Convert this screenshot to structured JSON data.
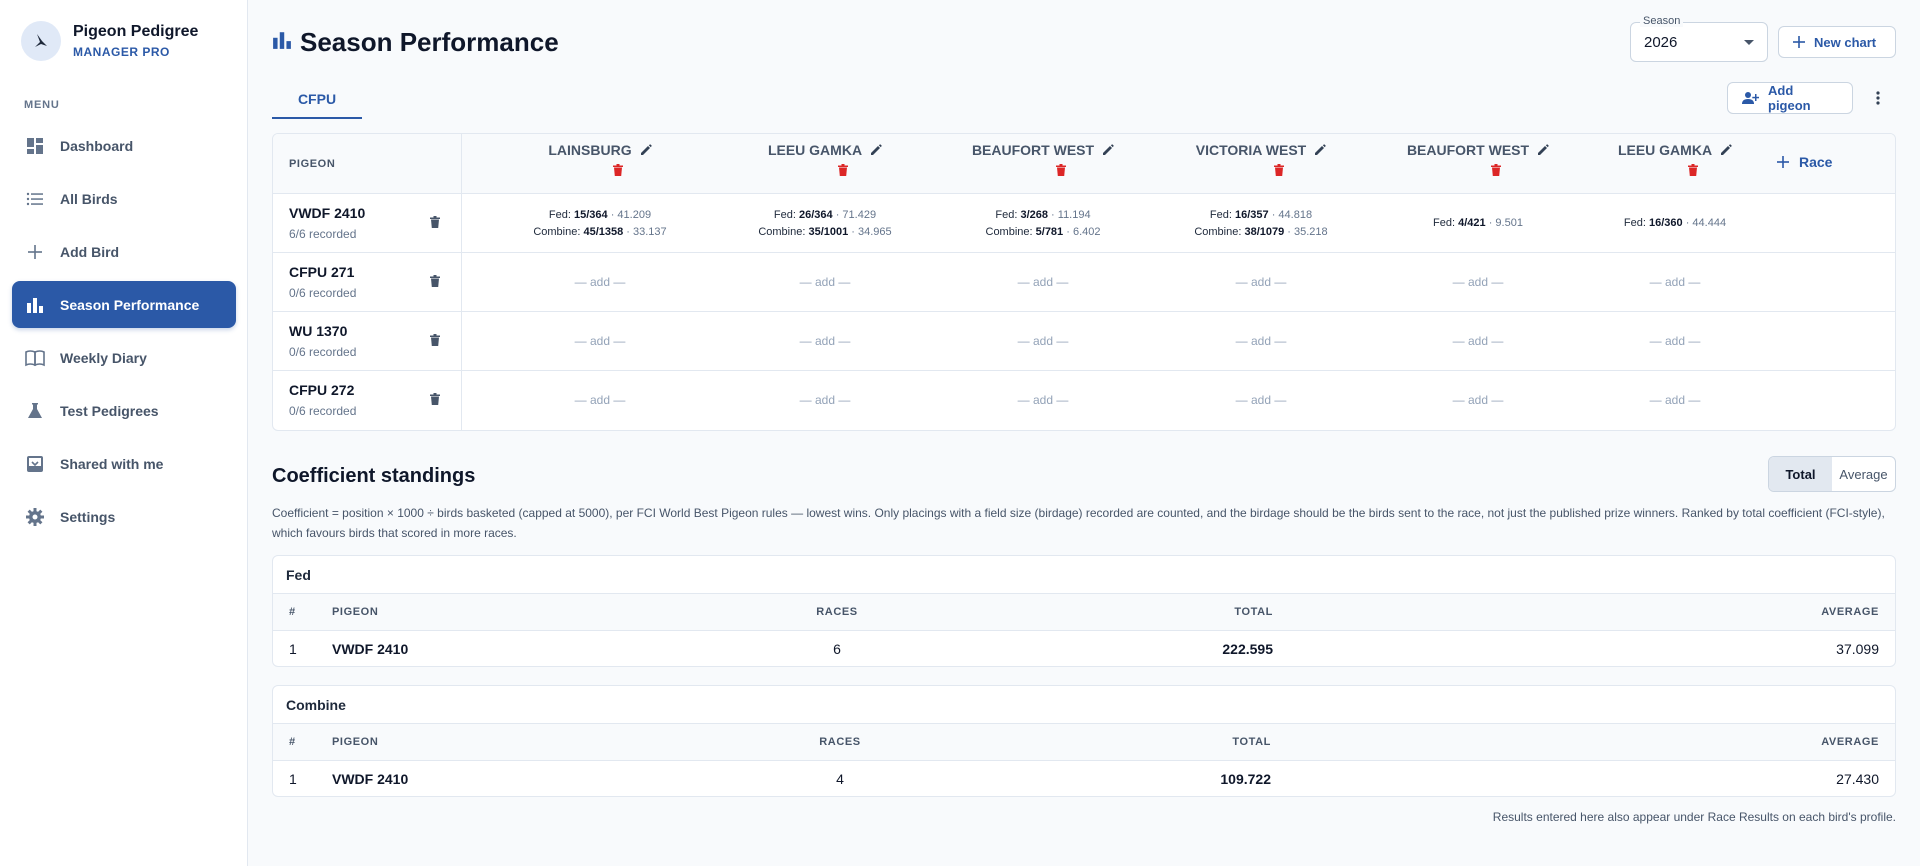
{
  "brand": {
    "name": "Pigeon Pedigree",
    "subtitle": "MANAGER PRO"
  },
  "sidebar": {
    "menu_label": "MENU",
    "items": [
      {
        "label": "Dashboard",
        "icon": "dashboard-icon"
      },
      {
        "label": "All Birds",
        "icon": "list-icon"
      },
      {
        "label": "Add Bird",
        "icon": "plus-icon"
      },
      {
        "label": "Season Performance",
        "icon": "bar-chart-icon",
        "active": true
      },
      {
        "label": "Weekly Diary",
        "icon": "book-icon"
      },
      {
        "label": "Test Pedigrees",
        "icon": "flask-icon"
      },
      {
        "label": "Shared with me",
        "icon": "inbox-icon"
      },
      {
        "label": "Settings",
        "icon": "gear-icon"
      }
    ]
  },
  "header": {
    "title": "Season Performance",
    "season_label": "Season",
    "season_value": "2026",
    "new_chart": "New chart",
    "add_pigeon": "Add pigeon"
  },
  "tabs": [
    {
      "label": "CFPU",
      "active": true
    }
  ],
  "race_table": {
    "pigeon_header": "PIGEON",
    "add_race": "Race",
    "races": [
      "LAINSBURG",
      "LEEU GAMKA",
      "BEAUFORT WEST",
      "VICTORIA WEST",
      "BEAUFORT WEST",
      "LEEU GAMKA"
    ],
    "empty_label": "— add —",
    "rows": [
      {
        "pigeon": "VWDF 2410",
        "recorded": "6/6 recorded",
        "cells": [
          {
            "fed_label": "Fed:",
            "fed": "15/364",
            "fed_coef": "· 41.209",
            "comb_label": "Combine:",
            "comb": "45/1358",
            "comb_coef": "· 33.137"
          },
          {
            "fed_label": "Fed:",
            "fed": "26/364",
            "fed_coef": "· 71.429",
            "comb_label": "Combine:",
            "comb": "35/1001",
            "comb_coef": "· 34.965"
          },
          {
            "fed_label": "Fed:",
            "fed": "3/268",
            "fed_coef": "· 11.194",
            "comb_label": "Combine:",
            "comb": "5/781",
            "comb_coef": "· 6.402"
          },
          {
            "fed_label": "Fed:",
            "fed": "16/357",
            "fed_coef": "· 44.818",
            "comb_label": "Combine:",
            "comb": "38/1079",
            "comb_coef": "· 35.218"
          },
          {
            "fed_label": "Fed:",
            "fed": "4/421",
            "fed_coef": "· 9.501"
          },
          {
            "fed_label": "Fed:",
            "fed": "16/360",
            "fed_coef": "· 44.444"
          }
        ]
      },
      {
        "pigeon": "CFPU 271",
        "recorded": "0/6 recorded",
        "cells": []
      },
      {
        "pigeon": "WU 1370",
        "recorded": "0/6 recorded",
        "cells": []
      },
      {
        "pigeon": "CFPU 272",
        "recorded": "0/6 recorded",
        "cells": []
      }
    ]
  },
  "standings": {
    "title": "Coefficient standings",
    "toggle": [
      "Total",
      "Average"
    ],
    "toggle_selected": "Total",
    "description": "Coefficient = position × 1000 ÷ birds basketed (capped at 5000), per FCI World Best Pigeon rules — lowest wins. Only placings with a field size (birdage) recorded are counted, and the birdage should be the birds sent to the race, not just the published prize winners. Ranked by total coefficient (FCI-style), which favours birds that scored in more races.",
    "columns": {
      "rank": "#",
      "pigeon": "PIGEON",
      "races": "RACES",
      "total": "TOTAL",
      "average": "AVERAGE"
    },
    "fed": {
      "title": "Fed",
      "rows": [
        {
          "rank": "1",
          "pigeon": "VWDF 2410",
          "races": "6",
          "total": "222.595",
          "average": "37.099"
        }
      ]
    },
    "combine": {
      "title": "Combine",
      "rows": [
        {
          "rank": "1",
          "pigeon": "VWDF 2410",
          "races": "4",
          "total": "109.722",
          "average": "27.430"
        }
      ]
    }
  },
  "footnote": "Results entered here also appear under Race Results on each bird's profile.",
  "colors": {
    "accent": "#2b59a7",
    "danger": "#dc2626",
    "border": "#e2e8f0"
  }
}
